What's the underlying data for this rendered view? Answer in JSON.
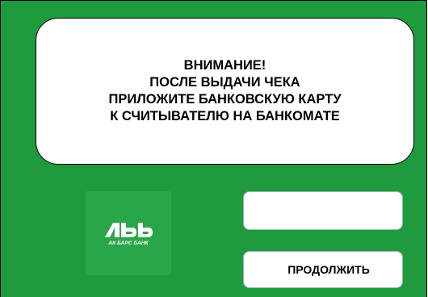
{
  "colors": {
    "background": "#1f9a3c",
    "logo_tile": "#2aa64a",
    "panel": "#ffffff",
    "text": "#000000"
  },
  "message": {
    "lines": [
      "ВНИМАНИЕ!",
      "ПОСЛЕ ВЫДАЧИ ЧЕКА",
      "ПРИЛОЖИТЕ БАНКОВСКУЮ КАРТУ",
      "К СЧИТЫВАТЕЛЮ НА БАНКОМАТЕ"
    ]
  },
  "logo": {
    "icon": "ak-bars-bank-logo",
    "wordmark": "Лbb",
    "caption": "АК БАРС БАНК"
  },
  "buttons": {
    "blank_label": "",
    "continue_label": "ПРОДОЛЖИТЬ"
  }
}
